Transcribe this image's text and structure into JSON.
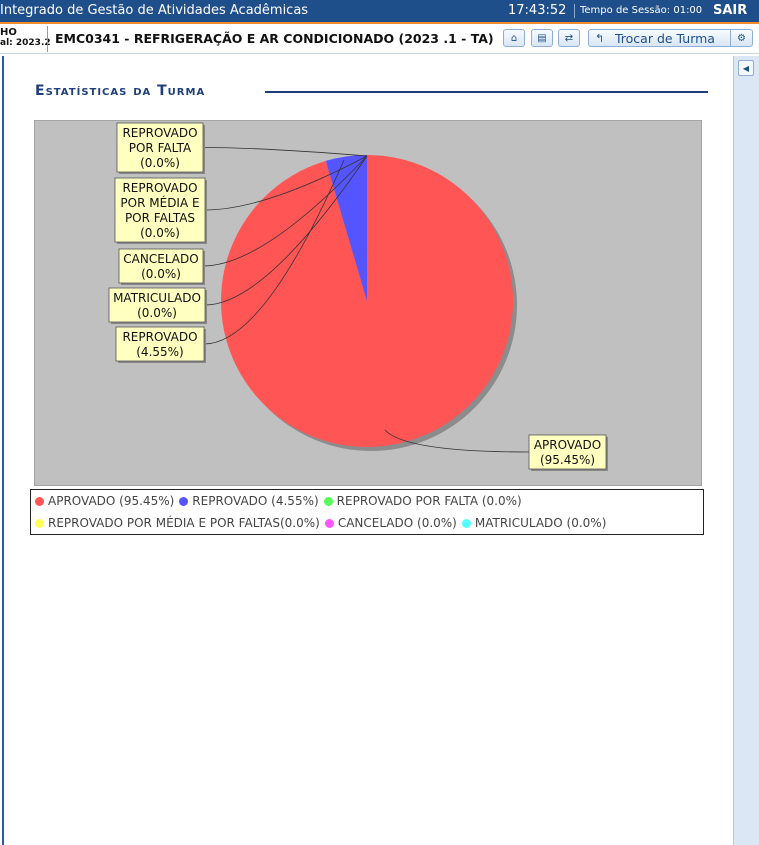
{
  "topbar": {
    "system_title": "Integrado de Gestão de Atividades Acadêmicas",
    "clock": "17:43:52",
    "session_label": "Tempo de Sessão: 01:00",
    "logout": "SAIR"
  },
  "subbar": {
    "user_line1": "HO",
    "user_line2": "al: 2023.2",
    "course": "EMC0341 - REFRIGERAÇÃO E AR CONDICIONADO (2023 .1 - TA)",
    "switch_class": "Trocar de Turma",
    "icons": [
      "home-icon",
      "print-icon",
      "swap-icon",
      "gear-icon"
    ]
  },
  "page": {
    "section_title": "Estatísticas da Turma"
  },
  "chart_data": {
    "type": "pie",
    "labels": [
      "APROVADO",
      "REPROVADO",
      "REPROVADO POR FALTA",
      "REPROVADO POR MÉDIA E POR FALTAS",
      "CANCELADO",
      "MATRICULADO"
    ],
    "values": [
      95.45,
      4.55,
      0.0,
      0.0,
      0.0,
      0.0
    ],
    "colors": [
      "#ff5555",
      "#5555ff",
      "#55ff55",
      "#ffff55",
      "#ff55ff",
      "#55ffff"
    ],
    "callouts": [
      {
        "lines": [
          "APROVADO",
          "(95.45%)"
        ]
      },
      {
        "lines": [
          "REPROVADO",
          "(4.55%)"
        ]
      },
      {
        "lines": [
          "REPROVADO",
          "POR FALTA",
          "(0.0%)"
        ]
      },
      {
        "lines": [
          "REPROVADO",
          "POR MÉDIA E",
          "POR FALTAS",
          "(0.0%)"
        ]
      },
      {
        "lines": [
          "CANCELADO",
          "(0.0%)"
        ]
      },
      {
        "lines": [
          "MATRICULADO",
          "(0.0%)"
        ]
      }
    ],
    "legend": [
      "APROVADO (95.45%)",
      "REPROVADO (4.55%)",
      "REPROVADO POR FALTA (0.0%)",
      "REPROVADO POR MÉDIA E POR FALTAS(0.0%)",
      "CANCELADO (0.0%)",
      "MATRICULADO (0.0%)"
    ],
    "plot_background": "#c0c0c0"
  }
}
